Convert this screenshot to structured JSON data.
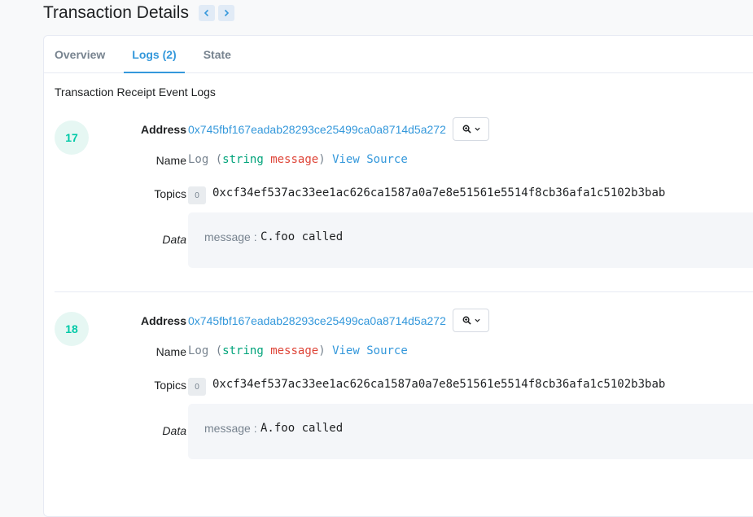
{
  "header": {
    "title": "Transaction Details",
    "prev_icon": "chevron-left-icon",
    "next_icon": "chevron-right-icon"
  },
  "tabs": [
    {
      "label": "Overview",
      "active": false
    },
    {
      "label": "Logs (2)",
      "active": true
    },
    {
      "label": "State",
      "active": false
    }
  ],
  "section_title": "Transaction Receipt Event Logs",
  "labels": {
    "address": "Address",
    "name": "Name",
    "topics": "Topics",
    "data": "Data"
  },
  "logs": [
    {
      "index": "17",
      "address": "0x745fbf167eadab28293ce25499ca0a8714d5a272",
      "name": {
        "func": "Log",
        "open": "(",
        "type": "string",
        "param": "message",
        "close": ")",
        "view_source": "View Source"
      },
      "topics": [
        {
          "badge": "0",
          "hash": "0xcf34ef537ac33ee1ac626ca1587a0a7e8e51561e5514f8cb36afa1c5102b3bab"
        }
      ],
      "data": {
        "key": "message :",
        "value": "C.foo called"
      }
    },
    {
      "index": "18",
      "address": "0x745fbf167eadab28293ce25499ca0a8714d5a272",
      "name": {
        "func": "Log",
        "open": "(",
        "type": "string",
        "param": "message",
        "close": ")",
        "view_source": "View Source"
      },
      "topics": [
        {
          "badge": "0",
          "hash": "0xcf34ef537ac33ee1ac626ca1587a0a7e8e51561e5514f8cb36afa1c5102b3bab"
        }
      ],
      "data": {
        "key": "message :",
        "value": "A.foo called"
      }
    }
  ],
  "colors": {
    "accent": "#3498db",
    "index_badge": "#00c9a7",
    "type": "#00a37a",
    "param": "#de4437"
  }
}
